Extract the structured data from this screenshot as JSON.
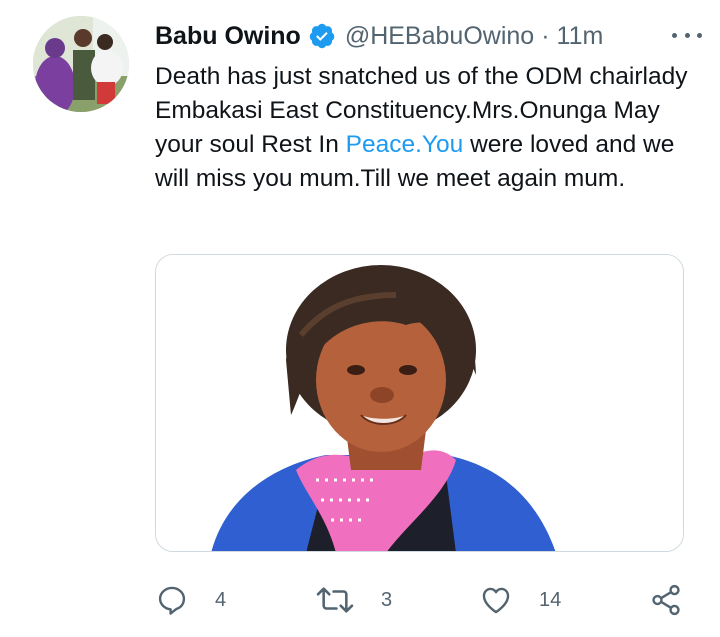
{
  "tweet": {
    "author_name": "Babu Owino",
    "handle": "@HEBabuOwino",
    "separator": "·",
    "time": "11m",
    "verified": true,
    "text_part1": "Death has just snatched us of the ODM chairlady Embakasi East Constituency.Mrs.Onunga May your soul Rest In ",
    "text_link": "Peace.You",
    "text_part2": " were loved and we will miss you mum.Till we meet again mum.",
    "link_color": "#1d9bf0"
  },
  "actions": {
    "reply": {
      "icon": "reply-icon",
      "count": "4"
    },
    "retweet": {
      "icon": "retweet-icon",
      "count": "3"
    },
    "like": {
      "icon": "heart-icon",
      "count": "14"
    },
    "share": {
      "icon": "share-icon"
    }
  },
  "colors": {
    "text": "#0f1419",
    "secondary": "#536471",
    "verified": "#1d9bf0",
    "border": "#cfd9de",
    "blouse": "#2f5fd0",
    "scarf": "#f06fbf"
  }
}
